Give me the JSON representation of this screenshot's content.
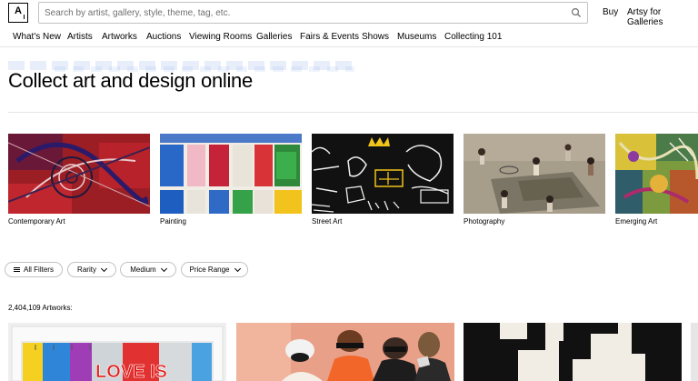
{
  "header": {
    "logo_text": "A",
    "search_placeholder": "Search by artist, gallery, style, theme, tag, etc.",
    "buy_label": "Buy",
    "galleries_label": "Artsy for Galleries"
  },
  "nav": [
    "What's New",
    "Artists",
    "Artworks",
    "Auctions",
    "Viewing Rooms",
    "Galleries",
    "Fairs & Events",
    "Shows",
    "Museums",
    "Collecting 101"
  ],
  "page": {
    "title": "Collect art and design online"
  },
  "categories": [
    {
      "label": "Contemporary Art"
    },
    {
      "label": "Painting"
    },
    {
      "label": "Street Art"
    },
    {
      "label": "Photography"
    },
    {
      "label": "Emerging Art"
    }
  ],
  "filters": {
    "all_filters": "All Filters",
    "rarity": "Rarity",
    "medium": "Medium",
    "price_range": "Price Range"
  },
  "results": {
    "count_text": "2,404,109 Artworks:"
  },
  "artwork_text": "LOVE IS",
  "colors": {
    "border": "#c2c2c2",
    "divider": "#e5e5e5",
    "text": "#000000",
    "placeholder": "#707070"
  }
}
